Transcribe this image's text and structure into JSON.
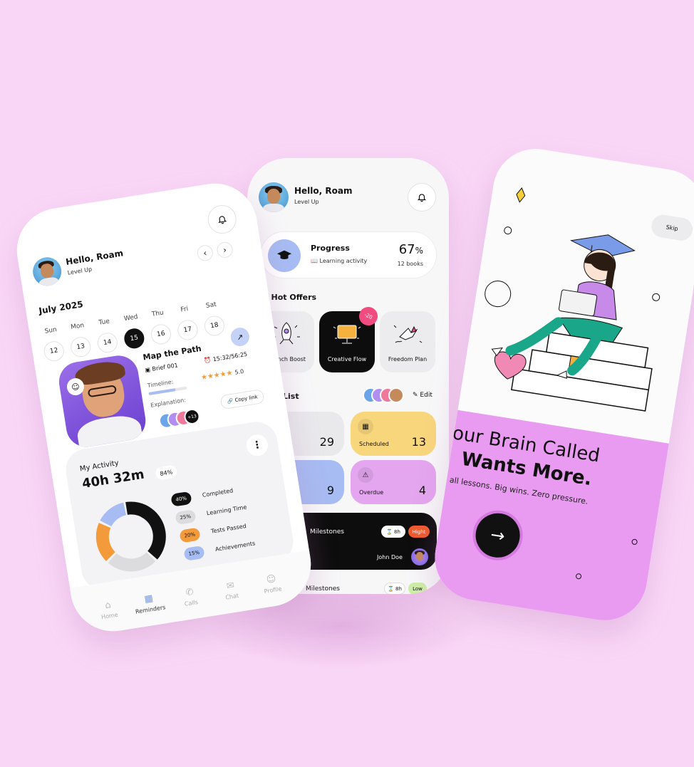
{
  "user": {
    "greeting": "Hello, Roam",
    "level": "Level Up"
  },
  "center": {
    "progress": {
      "title": "Progress",
      "subtitle": "Learning activity",
      "percent": "67",
      "percent_sign": "%",
      "books": "12 books"
    },
    "hot_offers": {
      "title": "Hot Offers",
      "items": [
        {
          "label": "Launch Boost"
        },
        {
          "label": "Creative Flow",
          "badge": "-20"
        },
        {
          "label": "Freedom Plan"
        }
      ]
    },
    "list": {
      "title": "List",
      "edit": "Edit",
      "cards": [
        {
          "label": "",
          "value": "29",
          "color": "#e9e9ec"
        },
        {
          "label": "Scheduled",
          "value": "13",
          "color": "#f8d67c"
        },
        {
          "label": "",
          "value": "9",
          "color": "#a7bcf2"
        },
        {
          "label": "Overdue",
          "value": "4",
          "color": "#e4a6ef"
        }
      ]
    },
    "milestones": {
      "title": "Milestones",
      "duration": "8h",
      "priority": "Hight",
      "assignee": "John Doe",
      "next_title": "Milestones",
      "next_duration": "8h",
      "next_priority": "Low"
    }
  },
  "left": {
    "month": "July 2025",
    "days": [
      "Sun",
      "Mon",
      "Tue",
      "Wed",
      "Thu",
      "Fri",
      "Sat"
    ],
    "dates": [
      "12",
      "13",
      "14",
      "15",
      "16",
      "17",
      "18"
    ],
    "active_date": "15",
    "prev": "‹",
    "next": "›",
    "task": {
      "title": "Map the Path",
      "brief": "Brief 001",
      "time": "15:32/56:25",
      "timeline": "Timeline:",
      "rating": "5.0",
      "explanation": "Explanation:",
      "copy_link": "Copy link",
      "more": "+13"
    },
    "activity": {
      "title": "My Activity",
      "duration": "40h 32m",
      "percent": "84%",
      "legend": [
        {
          "pct": "40%",
          "label": "Completed",
          "color": "#111111"
        },
        {
          "pct": "25%",
          "label": "Learning Time",
          "color": "#dcdcdf"
        },
        {
          "pct": "20%",
          "label": "Tests Passed",
          "color": "#f39b3a"
        },
        {
          "pct": "15%",
          "label": "Achievements",
          "color": "#a7bcf2"
        }
      ]
    },
    "tabs": [
      "Home",
      "Reminders",
      "Calls",
      "Chat",
      "Profile"
    ],
    "active_tab": "Reminders"
  },
  "right": {
    "skip": "Skip",
    "headline_1": "our Brain Called",
    "headline_2": "Wants More.",
    "sub": "all lessons. Big wins. Zero pressure."
  }
}
